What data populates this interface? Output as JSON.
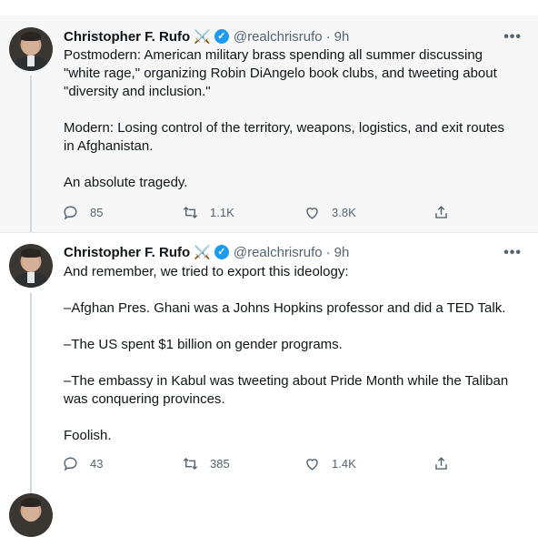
{
  "tweets": [
    {
      "author": {
        "name": "Christopher F. Rufo",
        "handle": "@realchrisrufo",
        "emoji": "⚔️"
      },
      "time": "9h",
      "paragraphs": [
        "Postmodern: American military brass spending all summer discussing \"white rage,\" organizing Robin DiAngelo book clubs, and tweeting about \"diversity and inclusion.\"",
        "Modern: Losing control of the territory, weapons, logistics, and exit routes in Afghanistan.",
        "An absolute tragedy."
      ],
      "replies": "85",
      "retweets": "1.1K",
      "likes": "3.8K"
    },
    {
      "author": {
        "name": "Christopher F. Rufo",
        "handle": "@realchrisrufo",
        "emoji": "⚔️"
      },
      "time": "9h",
      "paragraphs": [
        "And remember, we tried to export this ideology:",
        "–Afghan Pres. Ghani was a Johns Hopkins professor and did a TED Talk.",
        "–The US spent $1 billion on gender programs.",
        "–The embassy in Kabul was tweeting about Pride Month while the Taliban was conquering provinces.",
        "Foolish."
      ],
      "replies": "43",
      "retweets": "385",
      "likes": "1.4K"
    }
  ],
  "ui": {
    "more_glyph": "•••",
    "separator": "·",
    "verified_glyph": "✓"
  },
  "colors": {
    "accent": "#1d9bf0",
    "muted": "#536471",
    "highlight_bg": "#f7f7f7"
  }
}
